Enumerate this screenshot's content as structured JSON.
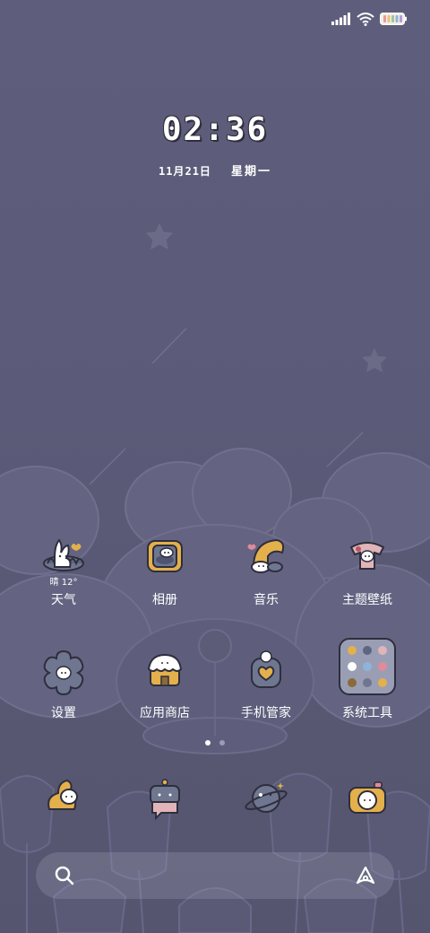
{
  "status_bar": {
    "signal_icon": "cellular-signal-icon",
    "wifi_icon": "wifi-icon",
    "battery_icon": "battery-icon"
  },
  "clock": {
    "time": "02:36",
    "date": "11月21日",
    "weekday": "星期一"
  },
  "apps": [
    {
      "label": "天气",
      "icon": "weather-bunny-icon",
      "extra": "晴 12°"
    },
    {
      "label": "相册",
      "icon": "gallery-bunny-icon"
    },
    {
      "label": "音乐",
      "icon": "music-bunny-icon"
    },
    {
      "label": "主题壁纸",
      "icon": "theme-bunny-icon"
    },
    {
      "label": "设置",
      "icon": "settings-flower-icon"
    },
    {
      "label": "应用商店",
      "icon": "app-store-bunny-icon"
    },
    {
      "label": "手机管家",
      "icon": "phone-manager-heart-icon"
    },
    {
      "label": "系统工具",
      "icon": "system-tools-folder-icon"
    }
  ],
  "dock": [
    {
      "icon": "phone-bunny-icon"
    },
    {
      "icon": "messages-bear-icon"
    },
    {
      "icon": "browser-planet-icon"
    },
    {
      "icon": "camera-bunny-icon"
    }
  ],
  "page_indicator": {
    "pages": 2,
    "current": 1
  },
  "search": {
    "search_icon": "search-icon",
    "assistant_icon": "assistant-a-icon"
  }
}
